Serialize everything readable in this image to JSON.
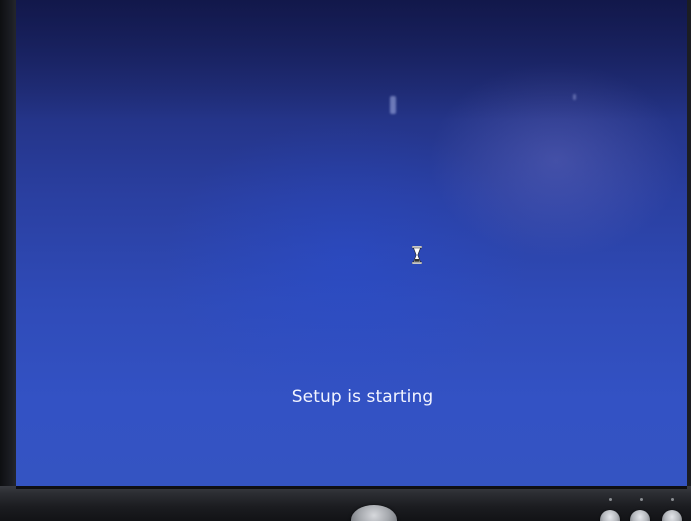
{
  "screen": {
    "status_text": "Setup is starting",
    "busy_indicator": "hourglass-icon",
    "background_color": "#2f4bb8",
    "text_color": "#f2f4ff"
  },
  "monitor": {
    "bezel_color": "#1b1c20",
    "buttons": [
      "power-button",
      "monitor-button",
      "monitor-button",
      "monitor-button"
    ]
  }
}
